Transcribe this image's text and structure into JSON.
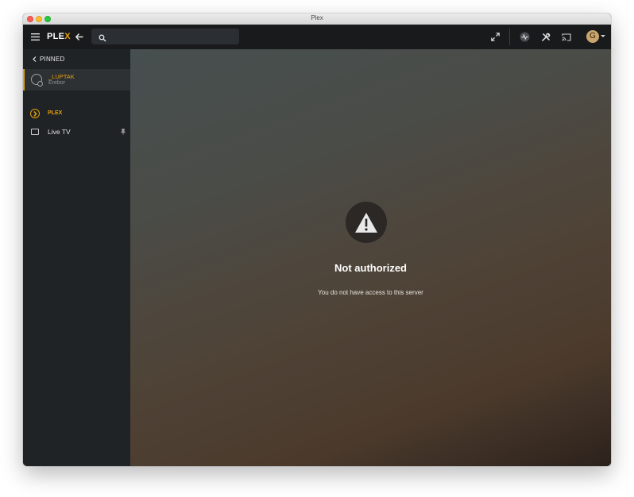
{
  "window": {
    "title": "Plex"
  },
  "topbar": {
    "logo_main": "PLE",
    "logo_accent": "X",
    "search": {
      "value": "",
      "placeholder": ""
    },
    "avatar_initial": "G",
    "icons": [
      "menu-icon",
      "back-arrow-icon",
      "search-icon",
      "fullscreen-icon",
      "activity-icon",
      "settings-icon",
      "cast-icon"
    ]
  },
  "sidebar": {
    "pinned_label": "PINNED",
    "server": {
      "name": "_LUPTAK",
      "subtitle": "Erebor"
    },
    "items": [
      {
        "label": "PLEX"
      },
      {
        "label": "Live TV"
      }
    ]
  },
  "main": {
    "error_title": "Not authorized",
    "error_message": "You do not have access to this server"
  },
  "colors": {
    "accent": "#e5a00d",
    "topbar": "#181a1c",
    "sidebar": "#1f2326"
  }
}
